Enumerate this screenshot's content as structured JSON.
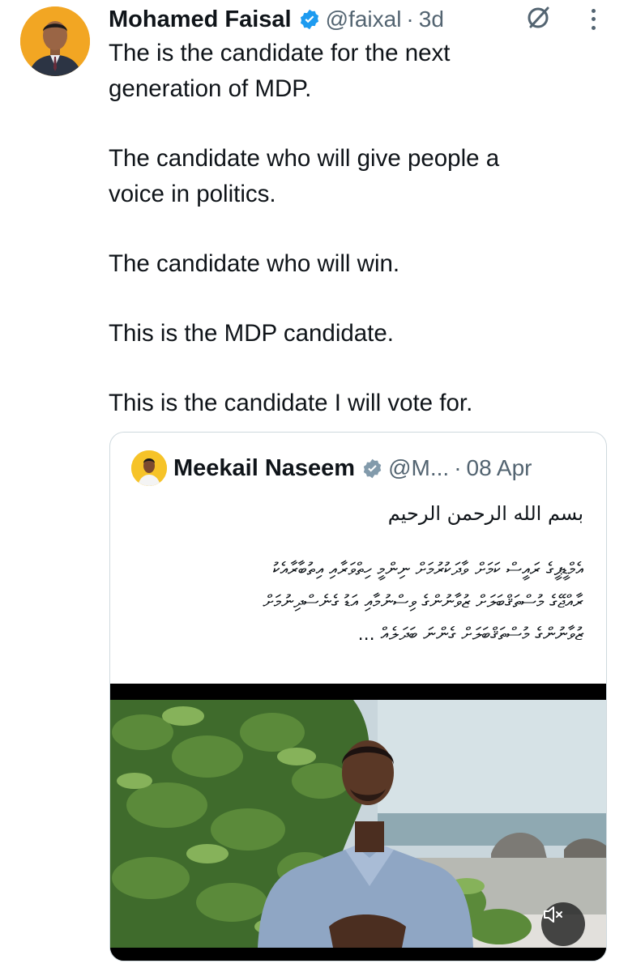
{
  "tweet": {
    "author_name": "Mohamed Faisal",
    "handle": "@faixal",
    "separator": "·",
    "age": "3d",
    "paragraphs": [
      "The is the candidate for the next\ngeneration of MDP.",
      "The candidate who will give people a\nvoice in politics.",
      "The candidate who will win.",
      "This is the MDP candidate.",
      "This is the candidate I will vote for."
    ]
  },
  "quote": {
    "author_name": "Meekail Naseem",
    "handle": "@M...",
    "separator": "·",
    "date": "08 Apr",
    "arabic_line": "بسم الله الرحمن الرحيم",
    "thaana_lines": [
      "އެމްޑީޕީގެ ރައީސް ކަމަށް ވާދަކުރުމަށް ނިންމީ ހިތްވަރާއި އިތުބާރާއެކު",
      "ރާއްޖޭގެ މުސްތަޤްބަލަށް ޒުވާނުންގެ ވިސްނުމާއި އަޑު ގެނެސްދިނުމަށް",
      "ޒުވާނުންގެ މުސްތަޤްބަލަށް ގެންނަ ބަދަލެއް ..."
    ]
  },
  "icons": {
    "verified": "verified-badge-icon",
    "grok": "grok-icon",
    "more": "more-icon",
    "mute": "mute-icon"
  },
  "colors": {
    "text": "#0f1419",
    "secondary": "#536471",
    "verified_blue": "#1d9bf0",
    "border": "#cfd9de"
  }
}
